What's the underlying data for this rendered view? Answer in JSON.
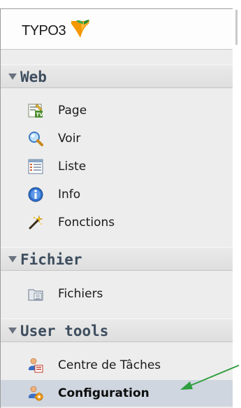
{
  "logo": {
    "text": "TYPO3",
    "icon": "typo3-logo-icon",
    "accent": "#f49700"
  },
  "groups": [
    {
      "label": "Web",
      "items": [
        {
          "label": "Page",
          "icon": "page-tv-icon"
        },
        {
          "label": "Voir",
          "icon": "magnifier-icon"
        },
        {
          "label": "Liste",
          "icon": "list-icon"
        },
        {
          "label": "Info",
          "icon": "info-icon"
        },
        {
          "label": "Fonctions",
          "icon": "wand-icon"
        }
      ]
    },
    {
      "label": "Fichier",
      "items": [
        {
          "label": "Fichiers",
          "icon": "filelist-icon"
        }
      ]
    },
    {
      "label": "User tools",
      "items": [
        {
          "label": "Centre de Tâches",
          "icon": "user-taskcenter-icon"
        },
        {
          "label": "Configuration",
          "icon": "user-setup-icon",
          "active": true
        }
      ]
    }
  ],
  "colors": {
    "panel_bg": "#ededed",
    "header_text": "#3d4d5e",
    "active_bg": "#cfd6e0",
    "arrow": "#2e9e3e"
  },
  "annotation": {
    "type": "arrow",
    "target": "Configuration",
    "color": "#2e9e3e"
  }
}
